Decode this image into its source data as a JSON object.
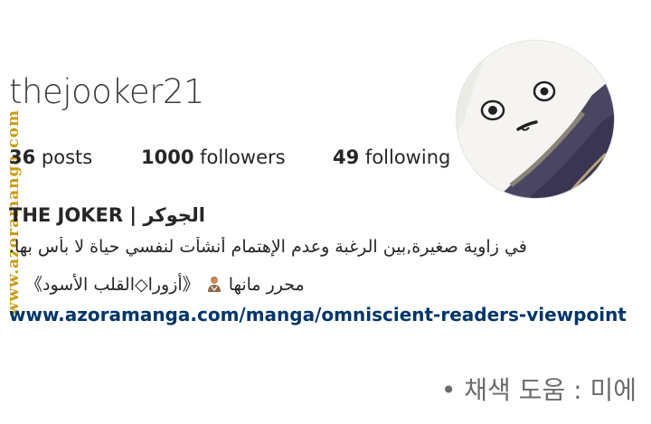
{
  "watermark": {
    "text": "www.azoramanga.com"
  },
  "profile": {
    "username": "thejooker21",
    "display_name": "THE JOKER | الجوكر"
  },
  "stats": {
    "posts_count": "36",
    "posts_label": "posts",
    "followers_count": "1000",
    "followers_label": "followers",
    "following_count": "49",
    "following_label": "following"
  },
  "bio": {
    "line1": "في زاوية صغيرة,بين الرغبة وعدم الإهتمام أنشأت لنفسي حياة لا بأس بها.",
    "line2_part1": "محرر مانها",
    "line2_part2": "《أزورا◇القلب الأسود》",
    "link": "www.azoramanga.com/manga/omniscient-readers-viewpoint"
  },
  "credit": {
    "text": "• 채색 도움 : 미에"
  },
  "icons": {
    "avatar": "avatar-cartoon-face",
    "editor": "person-emoji-icon"
  },
  "colors": {
    "link": "#003569",
    "watermark": "#c99a12",
    "text": "#262626"
  }
}
